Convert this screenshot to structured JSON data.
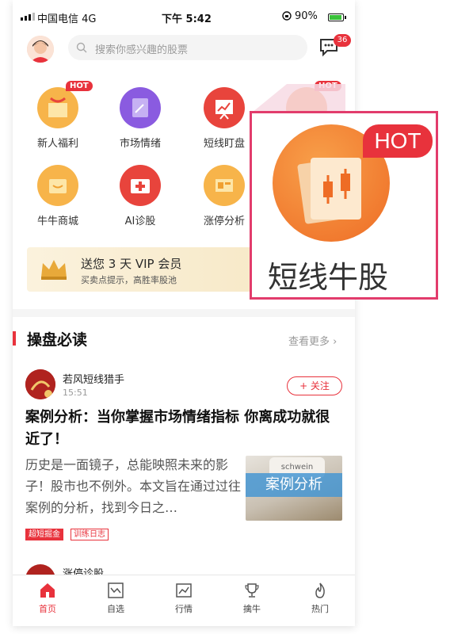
{
  "status": {
    "carrier": "中国电信 4G",
    "time": "下午 5:42",
    "battery": "90%"
  },
  "header": {
    "search_placeholder": "搜索你感兴趣的股票",
    "message_count": "36"
  },
  "grid": [
    {
      "label": "新人福利",
      "hot": "HOT",
      "color": "#f7b44a"
    },
    {
      "label": "市场情绪",
      "color": "#8a5be0"
    },
    {
      "label": "短线盯盘",
      "color": "#e8443c"
    },
    {
      "label": "短线牛股",
      "hot": "HOT",
      "color": "#f0782c"
    },
    {
      "label": "牛牛商城",
      "color": "#f7b44a"
    },
    {
      "label": "AI诊股",
      "color": "#e8443c"
    },
    {
      "label": "涨停分析",
      "color": "#f7b44a"
    }
  ],
  "vip": {
    "title": "送您 3 天 VIP 会员",
    "subtitle": "买卖点提示，高胜率股池"
  },
  "section": {
    "title": "操盘必读",
    "more": "查看更多"
  },
  "article": {
    "author": "若风短线猎手",
    "time": "15:51",
    "follow": "+ 关注",
    "title": "案例分析：当你掌握市场情绪指标 你离成功就很近了！",
    "body": "历史是一面镜子，总能映照未来的影子！股市也不例外。本文旨在通过过往案例的分析，找到今日之…",
    "image_label": "案例分析",
    "image_text": "schwein",
    "tags": [
      "超短掘金",
      "训练日志"
    ]
  },
  "next_article": {
    "author": "涨停诊股"
  },
  "tabs": [
    {
      "label": "首页",
      "icon": "home-icon",
      "active": true
    },
    {
      "label": "自选",
      "icon": "star-chart-icon"
    },
    {
      "label": "行情",
      "icon": "market-icon"
    },
    {
      "label": "擒牛",
      "icon": "trophy-icon"
    },
    {
      "label": "热门",
      "icon": "flame-icon"
    }
  ],
  "zoom": {
    "hot": "HOT",
    "label": "短线牛股"
  },
  "colors": {
    "accent": "#e8323c",
    "callout": "#e23c6c"
  }
}
